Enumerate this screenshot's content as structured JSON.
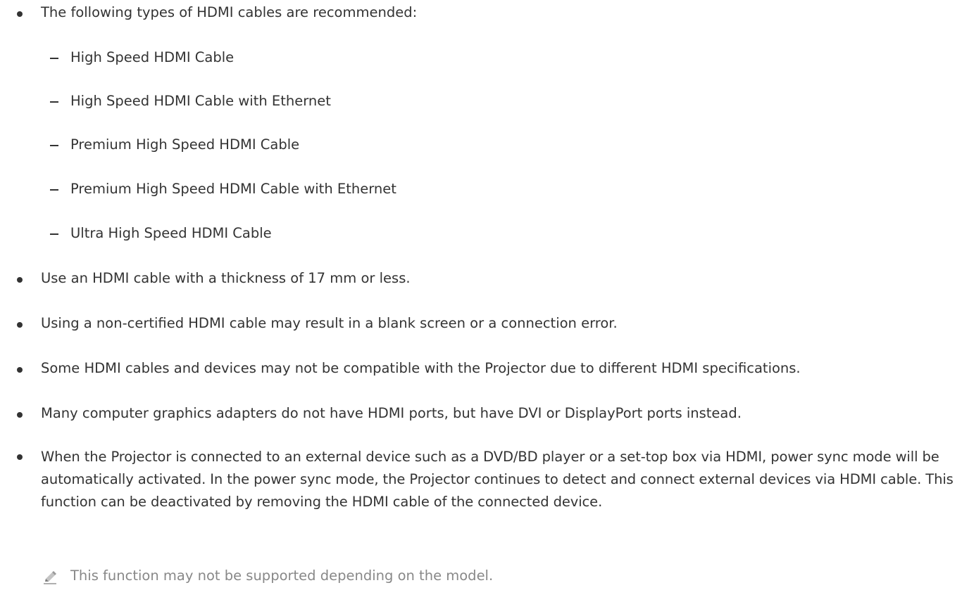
{
  "intro": "The following types of HDMI cables are recommended:",
  "cable_types": [
    "High Speed HDMI Cable",
    "High Speed HDMI Cable with Ethernet",
    "Premium High Speed HDMI Cable",
    "Premium High Speed HDMI Cable with Ethernet",
    "Ultra High Speed HDMI Cable"
  ],
  "bullets": [
    "Use an HDMI cable with a thickness of 17 mm or less.",
    "Using a non-certified HDMI cable may result in a blank screen or a connection error.",
    "Some HDMI cables and devices may not be compatible with the Projector due to different HDMI specifications.",
    "Many computer graphics adapters do not have HDMI ports, but have DVI or DisplayPort ports instead.",
    "When the Projector is connected to an external device such as a DVD/BD player or a set-top box via HDMI, power sync mode will be automatically activated. In the power sync mode, the Projector continues to detect and connect external devices via HDMI cable. This function can be deactivated by removing the HDMI cable of the connected device."
  ],
  "note": {
    "icon": "pencil-note-icon",
    "text": "This function may not be supported depending on the model."
  },
  "colors": {
    "text": "#333333",
    "note_text": "#888888"
  }
}
